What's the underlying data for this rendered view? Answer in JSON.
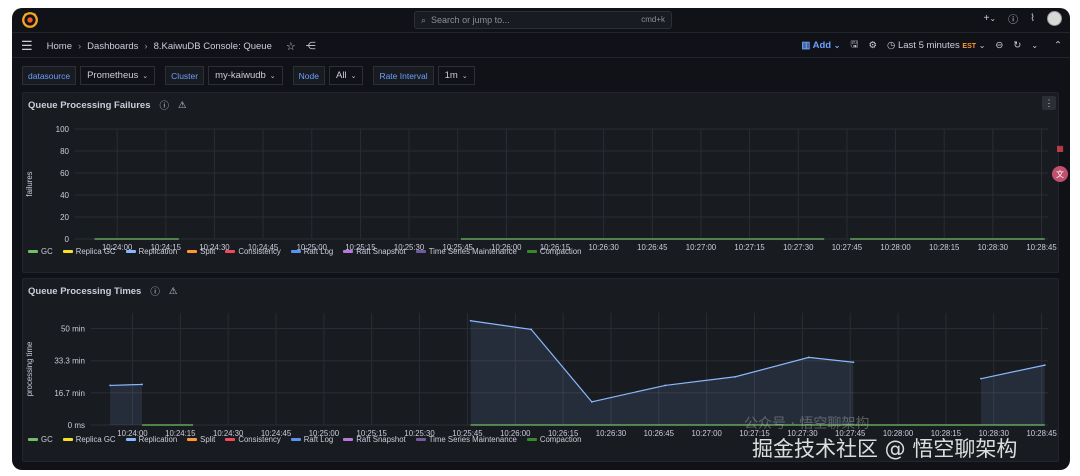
{
  "topbar": {
    "search_placeholder": "Search or jump to...",
    "search_shortcut": "cmd+k",
    "plus": "+",
    "chevron": "⌄"
  },
  "breadcrumb": {
    "home": "Home",
    "dashboards": "Dashboards",
    "current": "8.KaiwuDB Console: Queue"
  },
  "toolbar": {
    "add_label": "Add",
    "time_range": "Last 5 minutes",
    "timezone": "EST"
  },
  "variables": [
    {
      "label": "datasource",
      "value": "Prometheus"
    },
    {
      "label": "Cluster",
      "value": "my-kaiwudb"
    },
    {
      "label": "Node",
      "value": "All"
    },
    {
      "label": "Rate Interval",
      "value": "1m"
    }
  ],
  "legend": [
    {
      "name": "GC",
      "color": "#73bf69"
    },
    {
      "name": "Replica GC",
      "color": "#fade2a"
    },
    {
      "name": "Replication",
      "color": "#8ab8ff"
    },
    {
      "name": "Split",
      "color": "#ff9830"
    },
    {
      "name": "Consistency",
      "color": "#f2495c"
    },
    {
      "name": "Raft Log",
      "color": "#5794f2"
    },
    {
      "name": "Raft Snapshot",
      "color": "#b877d9"
    },
    {
      "name": "Time Series Maintenance",
      "color": "#705da0"
    },
    {
      "name": "Compaction",
      "color": "#37872d"
    }
  ],
  "chart_data": [
    {
      "type": "line",
      "title": "Queue Processing Failures",
      "ylabel": "failures",
      "ylim": [
        0,
        100
      ],
      "yticks": [
        "100",
        "80",
        "60",
        "40",
        "20",
        "0"
      ],
      "xticks": [
        "10:24:00",
        "10:24:15",
        "10:24:30",
        "10:24:45",
        "10:25:00",
        "10:25:15",
        "10:25:30",
        "10:25:45",
        "10:26:00",
        "10:26:15",
        "10:26:30",
        "10:26:45",
        "10:27:00",
        "10:27:15",
        "10:27:30",
        "10:27:45",
        "10:28:00",
        "10:28:15",
        "10:28:30",
        "10:28:45"
      ],
      "series": [
        {
          "name": "GC",
          "segments": [
            [
              "10:23:53",
              "10:24:19"
            ],
            [
              "10:25:46",
              "10:27:38"
            ],
            [
              "10:27:46",
              "10:28:46"
            ]
          ],
          "value": 0
        }
      ],
      "grid": true,
      "legend_placement": "bottom"
    },
    {
      "type": "area",
      "title": "Queue Processing Times",
      "ylabel": "processing time",
      "ylim_min": [
        0,
        58
      ],
      "yticks": [
        "50 min",
        "33.3 min",
        "16.7 min",
        "0 ms"
      ],
      "xticks": [
        "10:24:00",
        "10:24:15",
        "10:24:30",
        "10:24:45",
        "10:25:00",
        "10:25:15",
        "10:25:30",
        "10:25:45",
        "10:26:00",
        "10:26:15",
        "10:26:30",
        "10:26:45",
        "10:27:00",
        "10:27:15",
        "10:27:30",
        "10:27:45",
        "10:28:00",
        "10:28:15",
        "10:28:30",
        "10:28:45"
      ],
      "series": [
        {
          "name": "Replication",
          "segments": [
            [
              {
                "t": "10:23:53",
                "v": 20.5
              },
              {
                "t": "10:24:03",
                "v": 21
              }
            ],
            [
              {
                "t": "10:25:46",
                "v": 54
              },
              {
                "t": "10:26:05",
                "v": 49.5
              },
              {
                "t": "10:26:24",
                "v": 12
              },
              {
                "t": "10:26:47",
                "v": 20.5
              },
              {
                "t": "10:27:09",
                "v": 25
              },
              {
                "t": "10:27:32",
                "v": 35
              },
              {
                "t": "10:27:46",
                "v": 32.5
              }
            ],
            [
              {
                "t": "10:28:26",
                "v": 24
              },
              {
                "t": "10:28:46",
                "v": 31
              }
            ]
          ]
        },
        {
          "name": "GC",
          "segments": [
            [
              "10:24:03",
              "10:24:19"
            ],
            [
              "10:25:46",
              "10:28:46"
            ]
          ],
          "value": 0
        }
      ],
      "grid": true,
      "legend_placement": "bottom"
    }
  ],
  "watermark": {
    "line1": "公众号 · 悟空聊架构",
    "line2": "掘金技术社区 @ 悟空聊架构"
  }
}
